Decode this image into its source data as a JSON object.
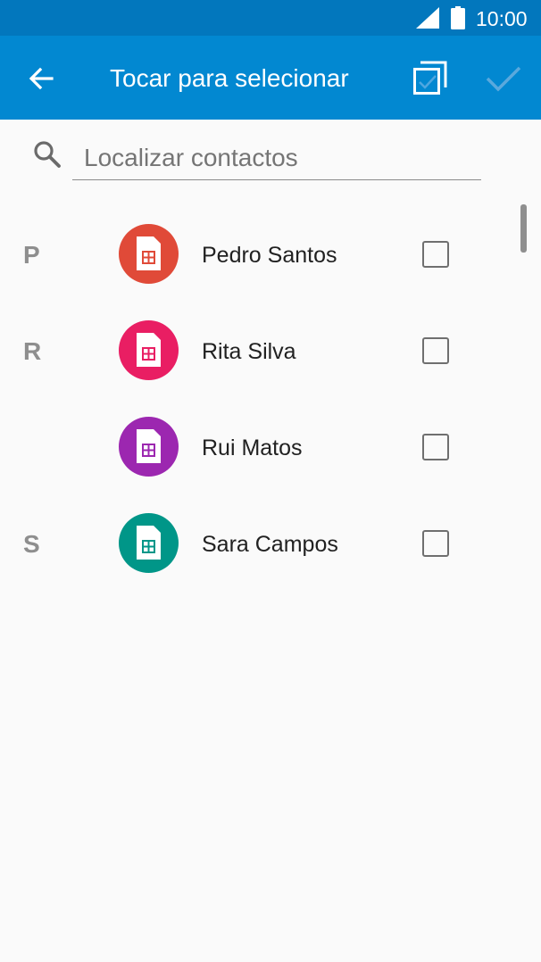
{
  "status_bar": {
    "time": "10:00",
    "signal_icon": "signal-icon",
    "battery_icon": "battery-icon"
  },
  "app_bar": {
    "title": "Tocar para selecionar",
    "back_icon": "arrow-back-icon",
    "select_all_icon": "select-all-icon",
    "done_icon": "checkmark-icon",
    "color": "#0288d1",
    "status_color": "#0277bd"
  },
  "search": {
    "placeholder": "Localizar contactos",
    "value": "",
    "icon": "search-icon"
  },
  "contacts": [
    {
      "section": "P",
      "name": "Pedro Santos",
      "color": "#e04a38",
      "icon": "sim-card-icon",
      "checked": false
    },
    {
      "section": "R",
      "name": "Rita Silva",
      "color": "#e91e63",
      "icon": "sim-card-icon",
      "checked": false
    },
    {
      "section": "",
      "name": "Rui Matos",
      "color": "#9c27b0",
      "icon": "sim-card-icon",
      "checked": false
    },
    {
      "section": "S",
      "name": "Sara Campos",
      "color": "#009688",
      "icon": "sim-card-icon",
      "checked": false
    }
  ]
}
